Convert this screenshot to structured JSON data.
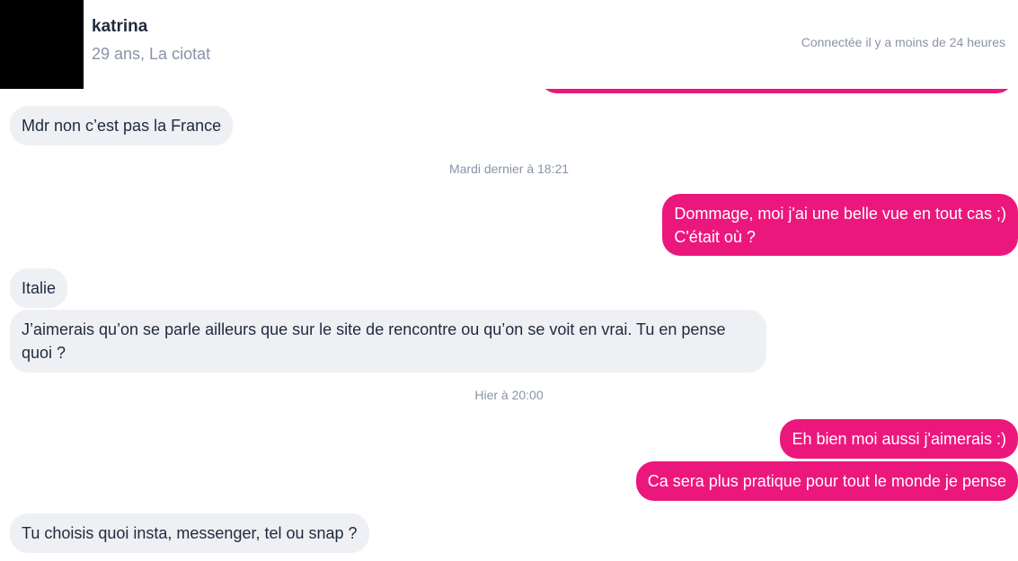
{
  "header": {
    "name": "katrina",
    "subtitle": "29 ans, La ciotat",
    "presence": "Connectée il y a moins de 24 heures"
  },
  "messages": [
    {
      "from": "them",
      "text": "Mdr non c’est pas la France"
    },
    {
      "type": "timestamp",
      "text": "Mardi dernier à 18:21"
    },
    {
      "from": "me",
      "line1": "Dommage, moi j'ai une belle vue en tout cas ;)",
      "line2": "C'était où ?"
    },
    {
      "from": "them",
      "text": "Italie"
    },
    {
      "from": "them",
      "text": "J’aimerais qu’on se parle ailleurs que sur le site de rencontre ou qu’on se voit en vrai. Tu en pense quoi ?"
    },
    {
      "type": "timestamp",
      "text": "Hier à 20:00"
    },
    {
      "from": "me",
      "text": "Eh bien moi aussi j'aimerais :)"
    },
    {
      "from": "me",
      "text": "Ca sera plus pratique pour tout le monde je pense"
    },
    {
      "from": "them",
      "text": "Tu choisis quoi insta, messenger, tel ou snap ?"
    }
  ],
  "colors": {
    "outgoing": "#ec177d",
    "incoming": "#eef0f4",
    "muted": "#8a93a6",
    "text": "#1f2a3d"
  }
}
